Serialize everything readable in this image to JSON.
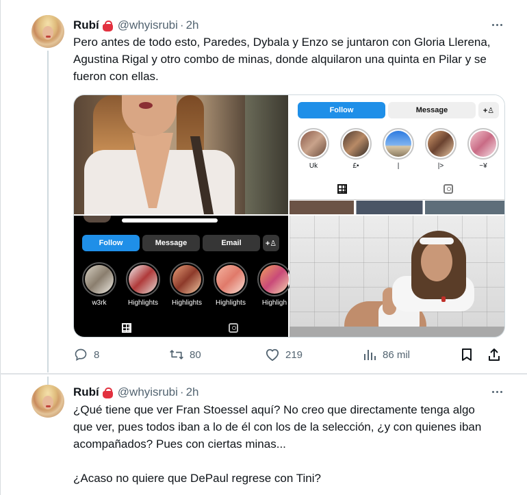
{
  "tweets": [
    {
      "author": {
        "name": "Rubí",
        "handle": "@whyisrubi",
        "time": "2h"
      },
      "text": "Pero antes de todo esto, Paredes, Dybala y Enzo se juntaron con Gloria Llerena, Agustina Rigal y otro combo de minas, donde alquilaron una quinta en Pilar y se fueron con ellas.",
      "media": {
        "top_right": {
          "buttons": {
            "follow": "Follow",
            "message": "Message"
          },
          "highlights": [
            "Uk",
            "£•",
            "|",
            "|>",
            "~¥"
          ]
        },
        "bottom_left": {
          "buttons": {
            "follow": "Follow",
            "message": "Message",
            "email": "Email"
          },
          "highlights": [
            "w3rk",
            "Highlights",
            "Highlights",
            "Highlights",
            "Highligh"
          ]
        }
      },
      "stats": {
        "replies": "8",
        "retweets": "80",
        "likes": "219",
        "views": "86 mil"
      }
    },
    {
      "author": {
        "name": "Rubí",
        "handle": "@whyisrubi",
        "time": "2h"
      },
      "text": "¿Qué tiene que ver Fran Stoessel aquí? No creo que directamente tenga algo que ver, pues todos iban a lo de él con los de la selección, ¿y con quienes iban acompañados? Pues con ciertas minas...\n\n¿Acaso no quiere que DePaul regrese con Tini?"
    }
  ],
  "colors": {
    "text": "#0f1419",
    "secondary": "#536471",
    "follow_blue": "#1f8fe8",
    "badge_red": "#e2313f"
  },
  "icons": [
    "handbag-emoji-icon",
    "more-icon",
    "reply-icon",
    "retweet-icon",
    "like-icon",
    "views-icon",
    "bookmark-icon",
    "share-icon",
    "grid-icon",
    "tagged-icon",
    "add-person-icon"
  ]
}
